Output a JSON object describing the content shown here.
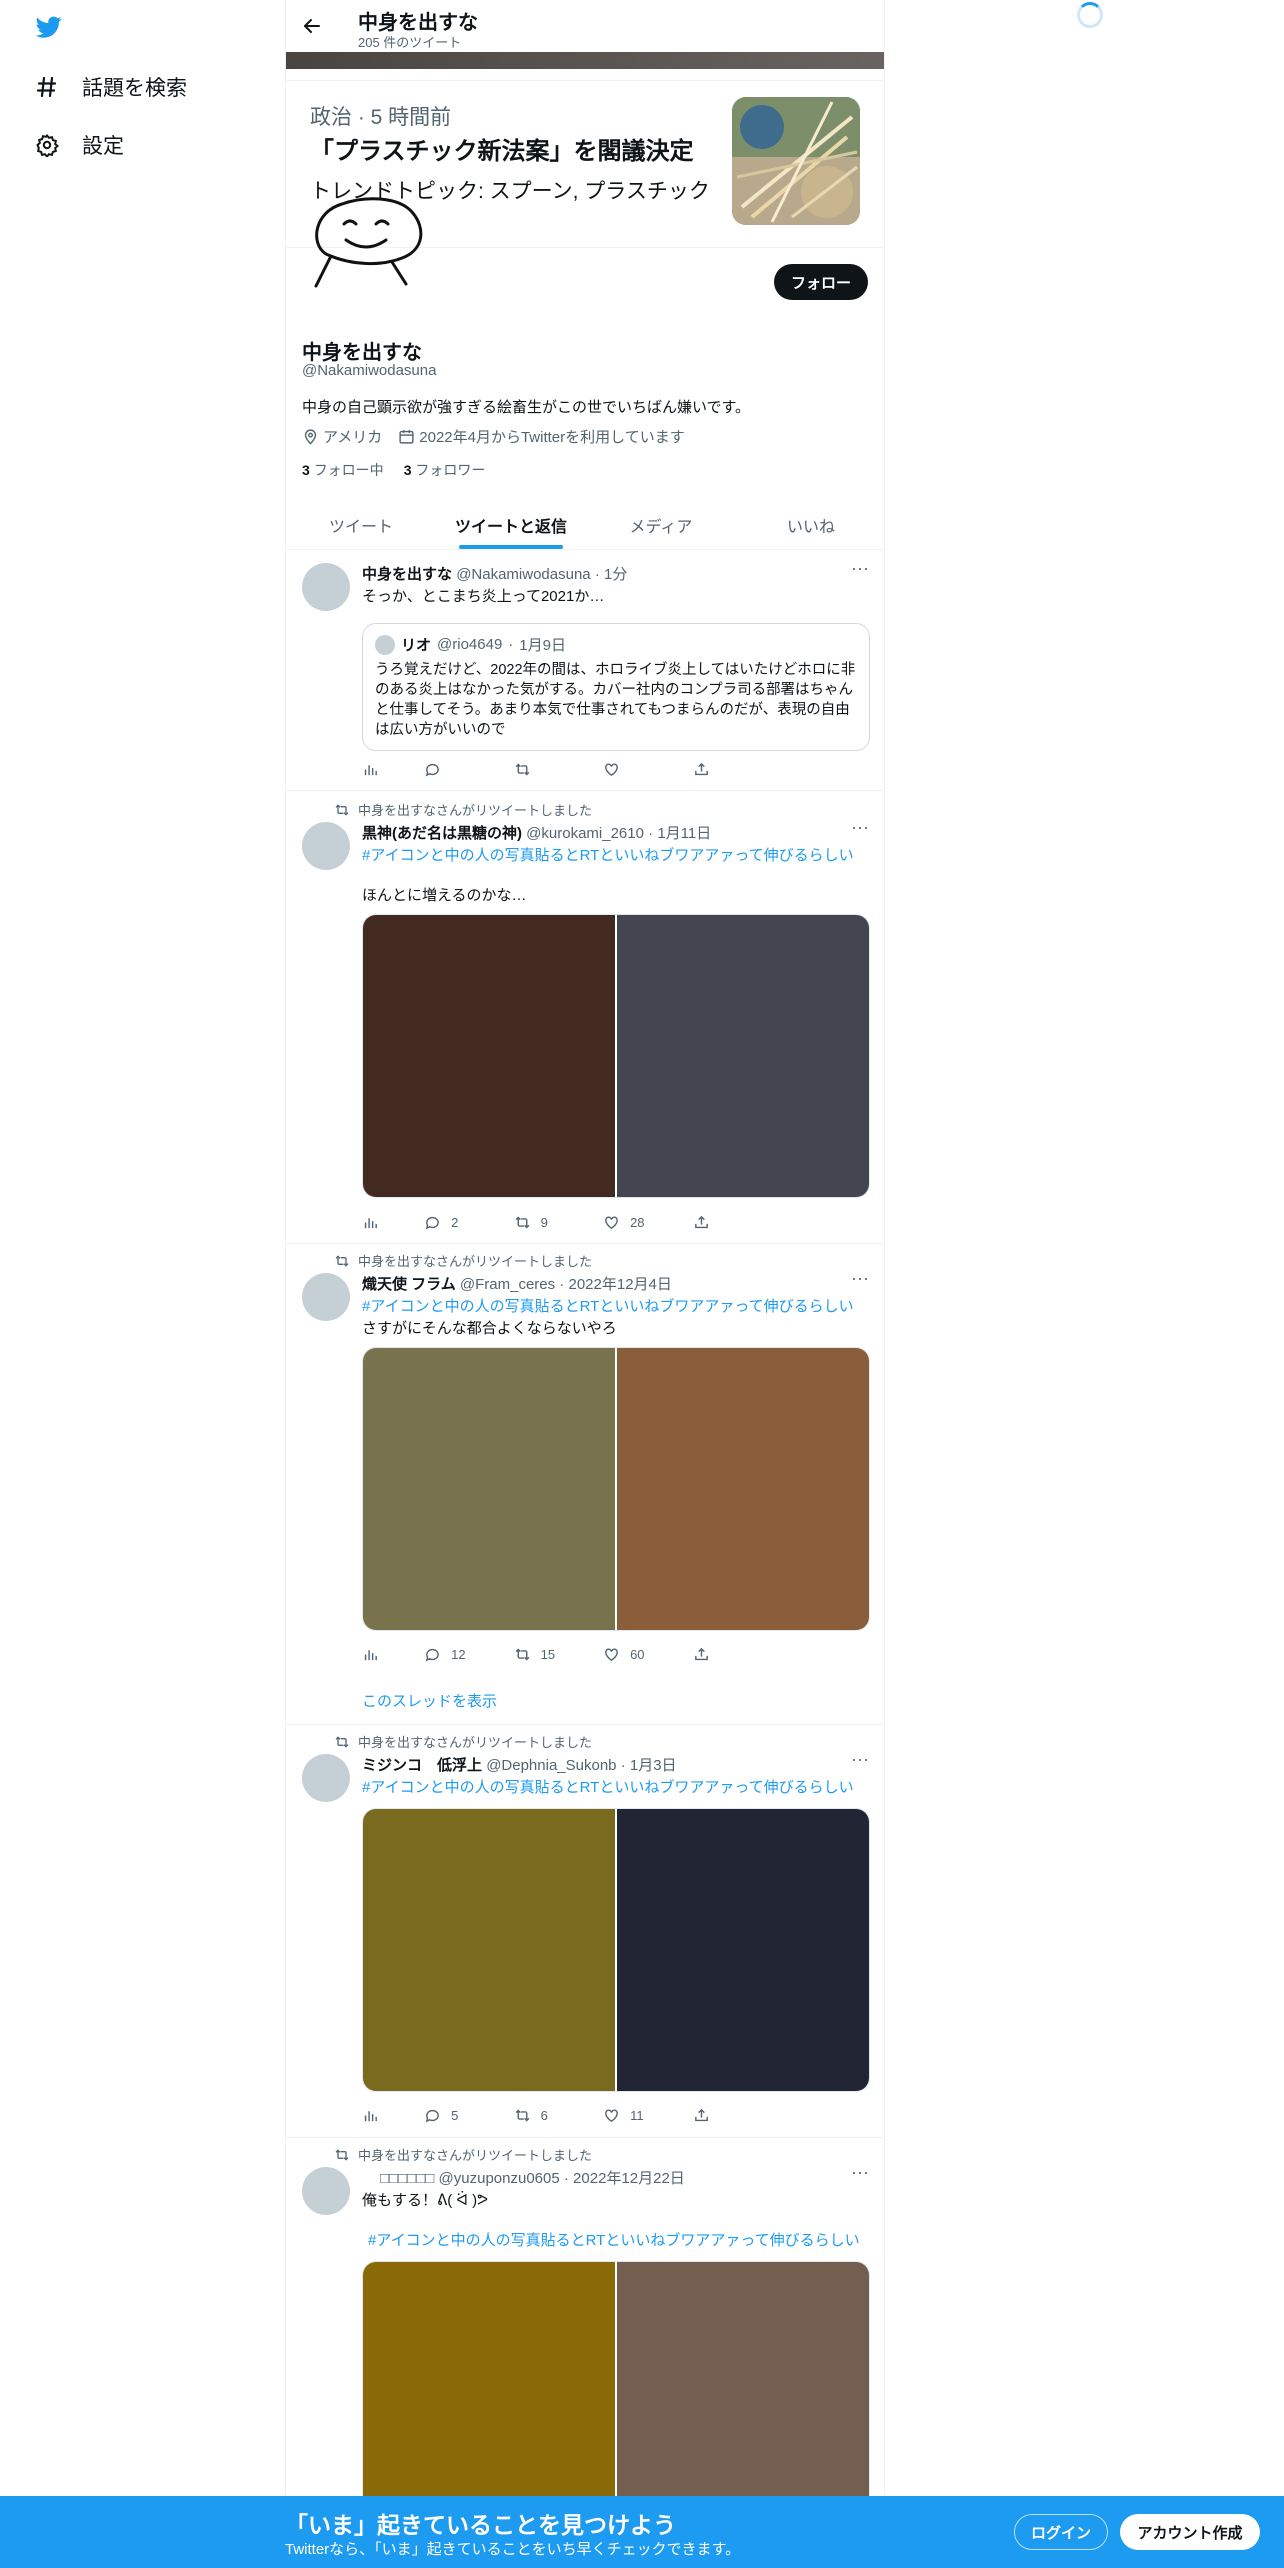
{
  "nav": {
    "logo": "twitter-bird-icon",
    "items": [
      {
        "label": "話題を検索",
        "icon": "hashtag-icon"
      },
      {
        "label": "設定",
        "icon": "gear-icon"
      }
    ]
  },
  "header": {
    "title": "中身を出すな",
    "tweet_count": "205 件のツイート"
  },
  "news": {
    "meta": "政治 · 5 時間前",
    "title": "「プラスチック新法案」を閣議決定",
    "topic": "トレンドトピック: スプーン, プラスチック"
  },
  "profile": {
    "name": "中身を出すな",
    "handle": "@Nakamiwodasuna",
    "bio": "中身の自己顕示欲が強すぎる絵畜生がこの世でいちばん嫌いです。",
    "location": "アメリカ",
    "joined": "2022年4月からTwitterを利用しています",
    "following_count": "3",
    "following_label": "フォロー中",
    "followers_count": "3",
    "followers_label": "フォロワー",
    "follow_button": "フォロー"
  },
  "tabs": [
    "ツイート",
    "ツイートと返信",
    "メディア",
    "いいね"
  ],
  "tweets": [
    {
      "name": "中身を出すな",
      "handle": "@Nakamiwodasuna",
      "time": "1分",
      "text": "そっか、とこまち炎上って2021か…",
      "quote": {
        "name": "リオ",
        "handle": "@rio4649",
        "time": "1月9日",
        "text": "うろ覚えだけど、2022年の間は、ホロライブ炎上してはいたけどホロに非のある炎上はなかった気がする。カバー社内のコンプラ司る部署はちゃんと仕事してそう。あまり本気で仕事されてもつまらんのだが、表現の自由は広い方がいいので"
      }
    },
    {
      "retweet_label": "中身を出すなさんがリツイートしました",
      "name": "黒神(あだ名は黒糖の神)",
      "handle": "@kurokami_2610",
      "time": "1月11日",
      "hashtag": "#アイコンと中の人の写真貼るとRTといいねブワアアァって伸びるらしい",
      "text": "ほんとに増えるのかな…",
      "media_colors": [
        "#422a20",
        "#434550"
      ],
      "replies": "2",
      "retweets": "9",
      "likes": "28"
    },
    {
      "retweet_label": "中身を出すなさんがリツイートしました",
      "name": "熾天使 フラム",
      "handle": "@Fram_ceres",
      "time": "2022年12月4日",
      "hashtag": "#アイコンと中の人の写真貼るとRTといいねブワアアァって伸びるらしい",
      "text": "さすがにそんな都合よくならないやろ",
      "media_colors": [
        "#78734d",
        "#8b5e3b"
      ],
      "replies": "12",
      "retweets": "15",
      "likes": "60",
      "show_thread": "このスレッドを表示"
    },
    {
      "retweet_label": "中身を出すなさんがリツイートしました",
      "name": "ミジンコ　低浮上",
      "handle": "@Dephnia_Sukonb",
      "time": "1月3日",
      "hashtag": "#アイコンと中の人の写真貼るとRTといいねブワアアァって伸びるらしい",
      "media_colors": [
        "#7a6a20",
        "#222634"
      ],
      "replies": "5",
      "retweets": "6",
      "likes": "11"
    },
    {
      "retweet_label": "中身を出すなさんがリツイートしました",
      "name": "□□□□□□",
      "handle": "@yuzuponzu0605",
      "time": "2022年12月22日",
      "text": "俺もする！ᕕ( ᐛ )ᕗ",
      "hashtag": "#アイコンと中の人の写真貼るとRTといいねブワアアァって伸びるらしい",
      "media_colors": [
        "#8a6a08",
        "#735e50"
      ]
    }
  ],
  "bottom": {
    "title": "「いま」起きていることを見つけよう",
    "subtitle": "Twitterなら、「いま」起きていることをいち早くチェックできます。",
    "login": "ログイン",
    "signup": "アカウント作成"
  },
  "colors": {
    "accent": "#1d9bf0",
    "text": "#0f1419",
    "muted": "#536471"
  }
}
